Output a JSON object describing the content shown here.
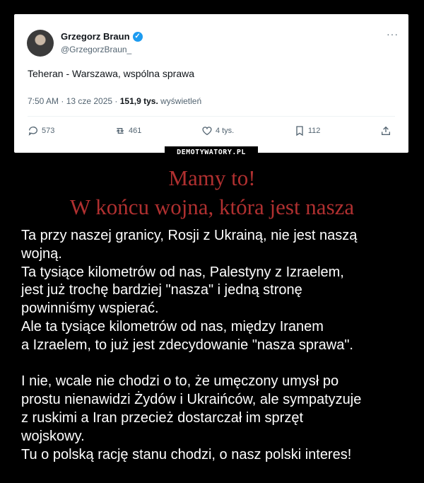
{
  "tweet": {
    "author_name": "Grzegorz Braun",
    "author_handle": "@GrzegorzBraun_",
    "text": "Teheran - Warszawa, wspólna sprawa",
    "time": "7:50 AM · 13 cze 2025 · ",
    "views_count": "151,9 tys.",
    "views_label": " wyświetleń",
    "more_glyph": "···",
    "replies": "573",
    "retweets": "461",
    "likes": "4 tys.",
    "bookmarks": "112",
    "accent_color": "#1d9bf0"
  },
  "watermark": "DEMOTYWATORY.PL",
  "title": {
    "line1": "Mamy to!",
    "line2": "W końcu wojna, która jest nasza",
    "color": "#b03030"
  },
  "body": {
    "lines": [
      "Ta przy naszej granicy, Rosji z Ukrainą, nie jest naszą",
      "wojną.",
      "Ta tysiące kilometrów od nas, Palestyny z Izraelem,",
      "jest już trochę bardziej \"nasza\" i jedną stronę",
      "powinniśmy wspierać.",
      "Ale ta tysiące kilometrów od nas, między Iranem",
      "a Izraelem, to już jest zdecydowanie \"nasza sprawa\".",
      "",
      "I nie, wcale nie chodzi o to, że umęczony umysł po",
      "prostu nienawidzi Żydów i Ukraińców, ale sympatyzuje",
      "z ruskimi a Iran przecież dostarczał im sprzęt",
      "wojskowy.",
      "Tu o polską rację stanu chodzi, o nasz polski interes!"
    ]
  }
}
